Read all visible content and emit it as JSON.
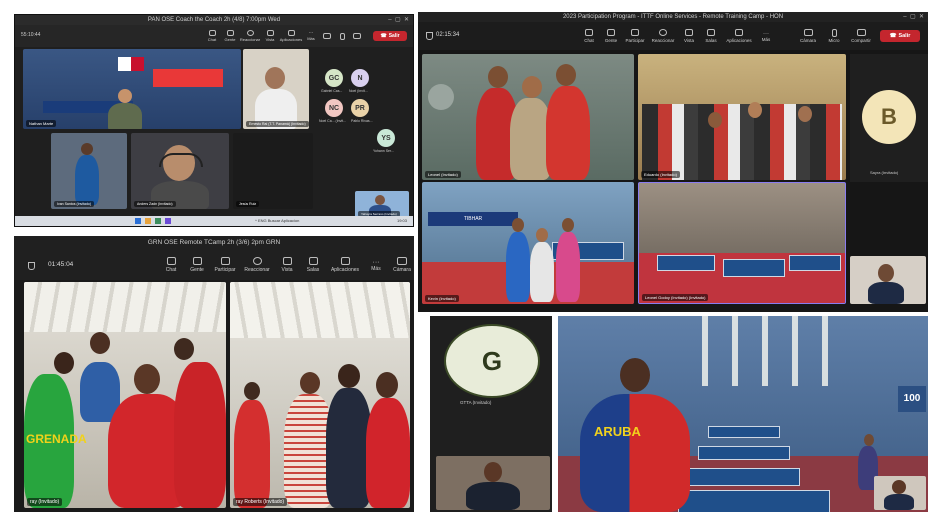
{
  "windows": {
    "top_left": {
      "title": "PAN OSE Coach the Coach 2h (4/8) 7:00pm Wed",
      "timer": "55:10:44",
      "toolbar": [
        "Chat",
        "Gente",
        "Reaccionar",
        "Vista",
        "Aplicaciones",
        "Más"
      ],
      "leave": "Salir",
      "participants": [
        {
          "name": "Nathan Marte"
        },
        {
          "name": "Ernesto Rai (T.T. Panamá) (Invitado)"
        },
        {
          "name": "Ivan Santos (Invitado)"
        },
        {
          "name": "Anders Zadn (Invitado)"
        },
        {
          "name": "Jesús Ruiz"
        },
        {
          "name": "Yahayra Serrano (Invitado)"
        }
      ],
      "avatars": [
        {
          "initials": "GC",
          "label": "Gabriel Cas...",
          "color": "#d6e6c7"
        },
        {
          "initials": "N",
          "label": "Noel (Invit...",
          "color": "#d9d0ef"
        },
        {
          "initials": "NC",
          "label": "Noel Ca... (Invit...",
          "color": "#f2c7c2"
        },
        {
          "initials": "PR",
          "label": "Pablo Rivas...",
          "color": "#ead2a8"
        },
        {
          "initials": "YS",
          "label": "Yohann Ser...",
          "color": "#c9e8d7"
        }
      ],
      "taskbar_time": "19:03",
      "taskbar_extra": "^  ENG  Buscar  Aplicacion"
    },
    "top_right": {
      "title": "2023 Participation Program - ITTF Online Services - Remote Training Camp - HON",
      "timer": "02:15:34",
      "toolbar": [
        "Chat",
        "Gente",
        "Participar",
        "Reaccionar",
        "Vista",
        "Salas",
        "Aplicaciones",
        "Más"
      ],
      "controls": [
        "Cámara",
        "Micro",
        "Compartir"
      ],
      "leave": "Salir",
      "participants": [
        {
          "name": "Leonel (Invitado)"
        },
        {
          "name": "Eduardo (Invitado)"
        },
        {
          "name": "Kevin (Invitado)"
        },
        {
          "name": "Leonel Godoy (Invitado) (Invitado)"
        },
        {
          "name": "Sayra (Invitado)"
        }
      ],
      "avatar": {
        "initials": "B",
        "color": "#f3e5b8"
      },
      "banner": "TIBHAR"
    },
    "bottom_left": {
      "title": "GRN OSE Remote TCamp 2h (3/6) 2pm GRN",
      "timer": "01:45:04",
      "toolbar": [
        "Chat",
        "Gente",
        "Participar",
        "Reaccionar",
        "Vista",
        "Salas",
        "Aplicaciones",
        "Más",
        "Cámara"
      ],
      "participants": [
        {
          "name": "ray (Invitado)"
        },
        {
          "name": "ray Roberts (Invitado)"
        }
      ],
      "shirt_text": "GRENADA"
    },
    "bottom_mid": {
      "avatar": {
        "initials": "G",
        "color": "#e8ecd9"
      },
      "label": "GTTA (Invitado)"
    },
    "bottom_right": {
      "shirt_text": "ARUBA",
      "sign": "100"
    }
  }
}
